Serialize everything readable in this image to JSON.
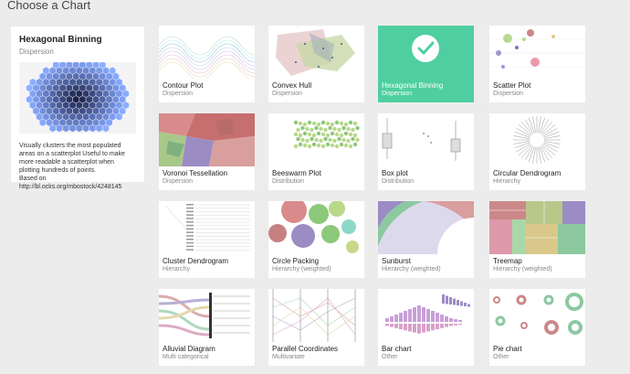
{
  "page": {
    "title": "Choose a Chart"
  },
  "selected": {
    "title": "Hexagonal Binning",
    "category": "Dispersion",
    "description": "Visually clusters the most populated areas on a scatterplot Useful to make more readable a scatterplot when plotting hundreds of points.",
    "based_on": "Based on",
    "source_url": "http://bl.ocks.org/mbostock/4248145"
  },
  "charts": [
    {
      "name": "Contour Plot",
      "category": "Dispersion",
      "icon": "contour-thumbnail"
    },
    {
      "name": "Convex Hull",
      "category": "Dispersion",
      "icon": "convex-hull-thumbnail"
    },
    {
      "name": "Hexagonal Binning",
      "category": "Dispersion",
      "icon": "checkmark-icon",
      "selected": true
    },
    {
      "name": "Scatter Plot",
      "category": "Dispersion",
      "icon": "scatter-thumbnail"
    },
    {
      "name": "Voronoi Tessellation",
      "category": "Dispersion",
      "icon": "voronoi-thumbnail"
    },
    {
      "name": "Beeswarm Plot",
      "category": "Distribution",
      "icon": "beeswarm-thumbnail"
    },
    {
      "name": "Box plot",
      "category": "Distribution",
      "icon": "boxplot-thumbnail"
    },
    {
      "name": "Circular Dendrogram",
      "category": "Hierarchy",
      "icon": "circular-dendrogram-thumbnail"
    },
    {
      "name": "Cluster Dendrogram",
      "category": "Hierarchy",
      "icon": "cluster-dendrogram-thumbnail"
    },
    {
      "name": "Circle Packing",
      "category": "Hierarchy (weighted)",
      "icon": "circle-packing-thumbnail"
    },
    {
      "name": "Sunburst",
      "category": "Hierarchy (weighted)",
      "icon": "sunburst-thumbnail"
    },
    {
      "name": "Treemap",
      "category": "Hierarchy (weighted)",
      "icon": "treemap-thumbnail"
    },
    {
      "name": "Alluvial Diagram",
      "category": "Multi categorical",
      "icon": "alluvial-thumbnail"
    },
    {
      "name": "Parallel Coordinates",
      "category": "Multivariate",
      "icon": "parallel-coordinates-thumbnail"
    },
    {
      "name": "Bar chart",
      "category": "Other",
      "icon": "bar-chart-thumbnail"
    },
    {
      "name": "Pie chart",
      "category": "Other",
      "icon": "pie-chart-thumbnail"
    }
  ],
  "colors": {
    "accent": "#4fcfa1",
    "background": "#ececec",
    "card": "#ffffff"
  }
}
